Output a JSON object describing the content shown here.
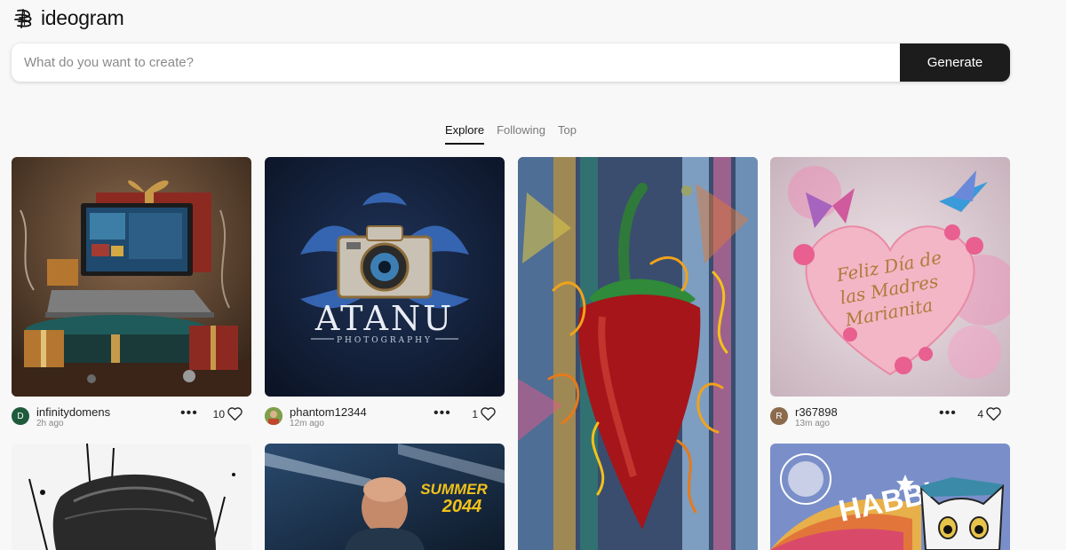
{
  "app": {
    "name": "ideogram"
  },
  "search": {
    "placeholder": "What do you want to create?",
    "value": ""
  },
  "generate_label": "Generate",
  "tabs": [
    {
      "label": "Explore",
      "active": true
    },
    {
      "label": "Following",
      "active": false
    },
    {
      "label": "Top",
      "active": false
    }
  ],
  "cards": [
    {
      "user": "infinitydomens",
      "initial": "D",
      "time": "2h ago",
      "likes": "10",
      "avatar_color": "#1e5a3c"
    },
    {
      "user": "phantom12344",
      "initial": "",
      "time": "12m ago",
      "likes": "1",
      "avatar_color": "#6a8a3a"
    },
    {
      "user": "r367898",
      "initial": "R",
      "time": "13m ago",
      "likes": "4",
      "avatar_color": "#8b6a4d"
    }
  ],
  "image_text": {
    "atanu": "ATANU",
    "photography": "PHOTOGRAPHY",
    "madres_1": "Feliz Día de",
    "madres_2": "las Madres",
    "madres_3": "Marianita",
    "summer": "SUMMER",
    "summer_year": "2044",
    "habbi": "HABBI"
  },
  "icons": {
    "logo": "ideogram-logo-icon",
    "more": "more-dots-icon",
    "like": "heart-icon"
  }
}
